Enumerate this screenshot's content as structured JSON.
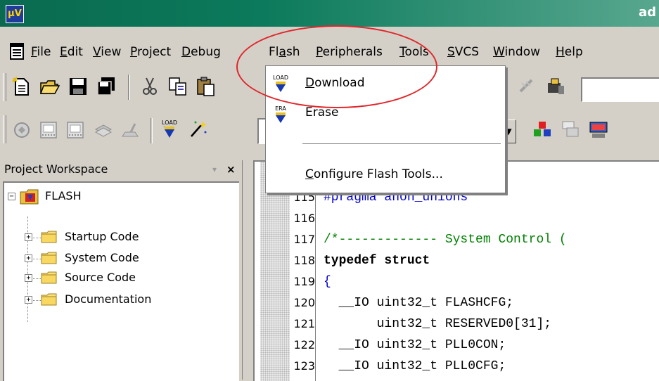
{
  "window": {
    "title_partial": "ad"
  },
  "menubar": {
    "items": [
      {
        "label": "File",
        "acc": "F"
      },
      {
        "label": "Edit",
        "acc": "E"
      },
      {
        "label": "View",
        "acc": "V"
      },
      {
        "label": "Project",
        "acc": "P"
      },
      {
        "label": "Debug",
        "acc": "D"
      },
      {
        "label": "Flash",
        "acc": "a"
      },
      {
        "label": "Peripherals",
        "acc": "P"
      },
      {
        "label": "Tools",
        "acc": "T"
      },
      {
        "label": "SVCS",
        "acc": "S"
      },
      {
        "label": "Window",
        "acc": "W"
      },
      {
        "label": "Help",
        "acc": "H"
      }
    ]
  },
  "flash_menu": {
    "download": {
      "label": "Download",
      "icon": "load-icon",
      "icon_text": "LOAD"
    },
    "erase": {
      "label": "Erase",
      "icon": "erase-icon",
      "icon_text": "ERA"
    },
    "configure": {
      "label": "Configure Flash Tools..."
    }
  },
  "workspace": {
    "title": "Project Workspace",
    "close_glyph": "×",
    "pin_glyph": "▾",
    "root": {
      "label": "FLASH",
      "expander": "−"
    },
    "groups": [
      {
        "label": "Startup Code",
        "expander": "+"
      },
      {
        "label": "System Code",
        "expander": "+"
      },
      {
        "label": "Source Code",
        "expander": "+"
      },
      {
        "label": "Documentation",
        "expander": "+"
      }
    ]
  },
  "editor": {
    "lines": [
      {
        "num": "115",
        "code": "#pragma anon_unions"
      },
      {
        "num": "116",
        "code": ""
      },
      {
        "num": "117",
        "code": "/*------------- System Control ("
      },
      {
        "num": "118",
        "code": "typedef struct"
      },
      {
        "num": "119",
        "code": "{"
      },
      {
        "num": "120",
        "code": "  __IO uint32_t FLASHCFG;"
      },
      {
        "num": "121",
        "code": "       uint32_t RESERVED0[31];"
      },
      {
        "num": "122",
        "code": "  __IO uint32_t PLL0CON;"
      },
      {
        "num": "123",
        "code": "  __IO uint32_t PLL0CFG;"
      }
    ]
  },
  "colors": {
    "titlebar": "#0c7a5c",
    "highlight_ellipse": "#e0262b",
    "comment": "#008000",
    "preprocessor": "#0000cc"
  }
}
